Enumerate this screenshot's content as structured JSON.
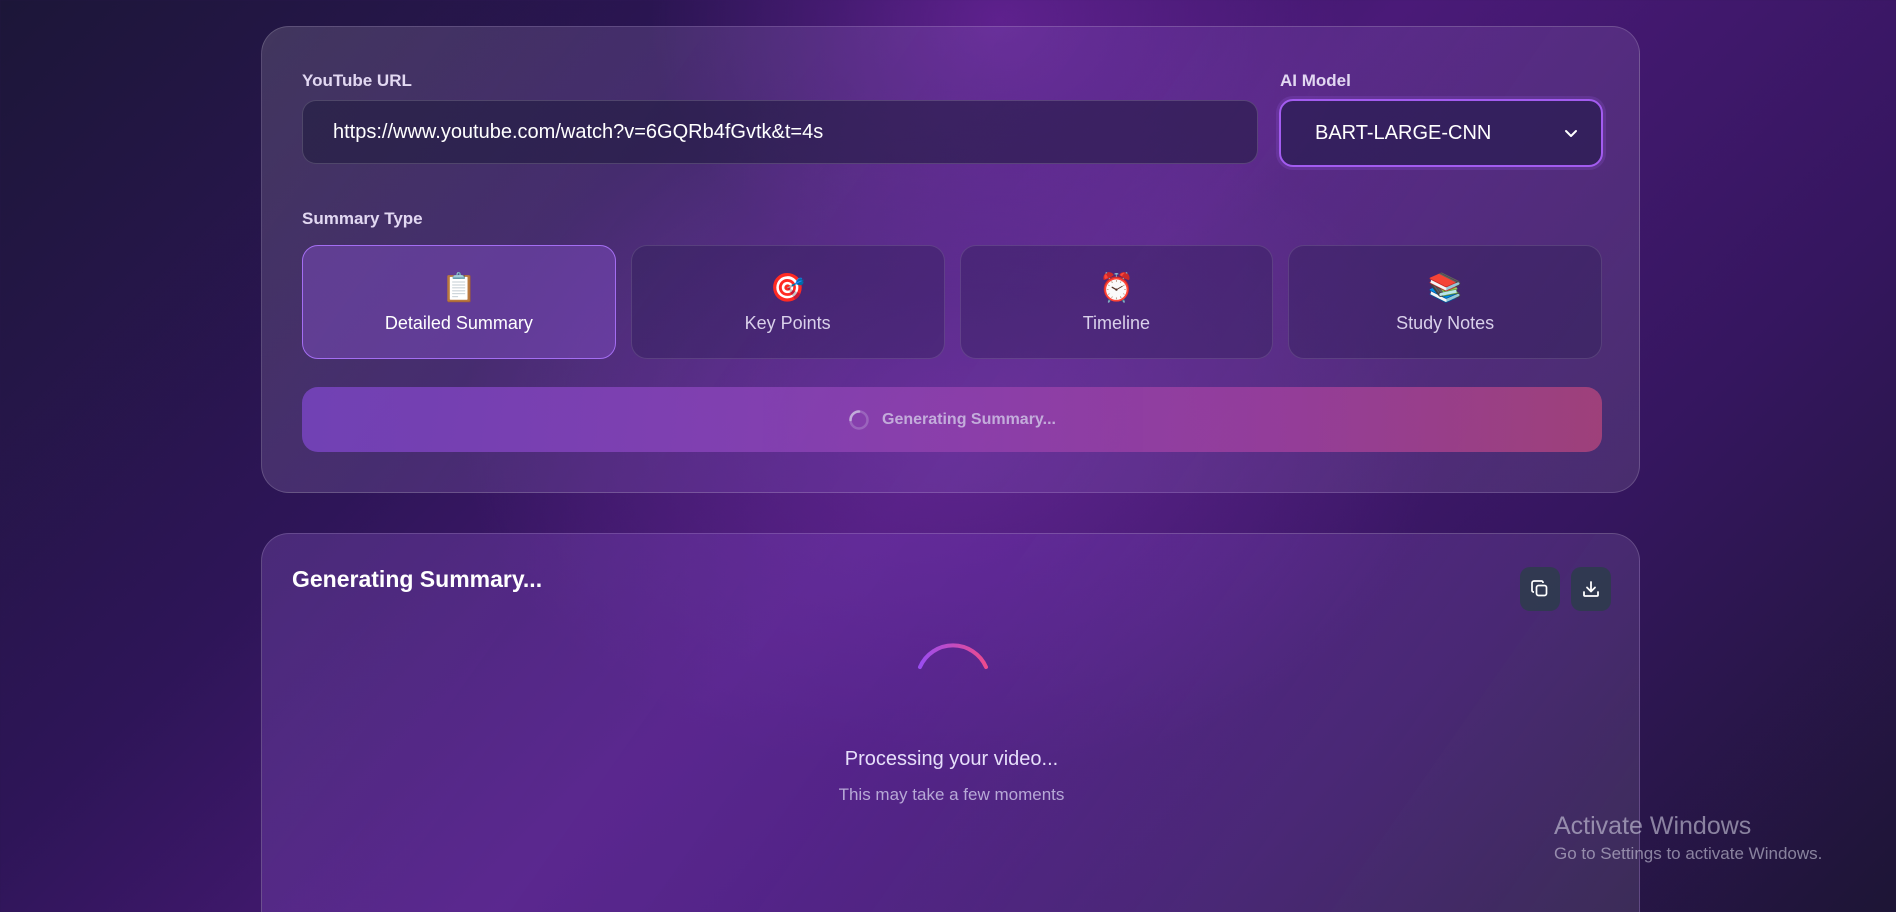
{
  "form": {
    "url_label": "YouTube URL",
    "url_value": "https://www.youtube.com/watch?v=6GQRb4fGvtk&t=4s",
    "model_label": "AI Model",
    "model_selected": "BART-LARGE-CNN",
    "summary_type_label": "Summary Type",
    "summary_types": [
      {
        "label": "Detailed Summary",
        "icon": "📋",
        "active": true
      },
      {
        "label": "Key Points",
        "icon": "🎯",
        "active": false
      },
      {
        "label": "Timeline",
        "icon": "⏰",
        "active": false
      },
      {
        "label": "Study Notes",
        "icon": "📚",
        "active": false
      }
    ],
    "generate_label": "Generating Summary..."
  },
  "result": {
    "title": "Generating Summary...",
    "processing_text": "Processing your video...",
    "processing_subtext": "This may take a few moments"
  },
  "watermark": {
    "line1": "Activate Windows",
    "line2": "Go to Settings to activate Windows."
  },
  "colors": {
    "accent": "#a35cf0",
    "button_start": "#7a45c4",
    "button_end": "#b0457c"
  }
}
